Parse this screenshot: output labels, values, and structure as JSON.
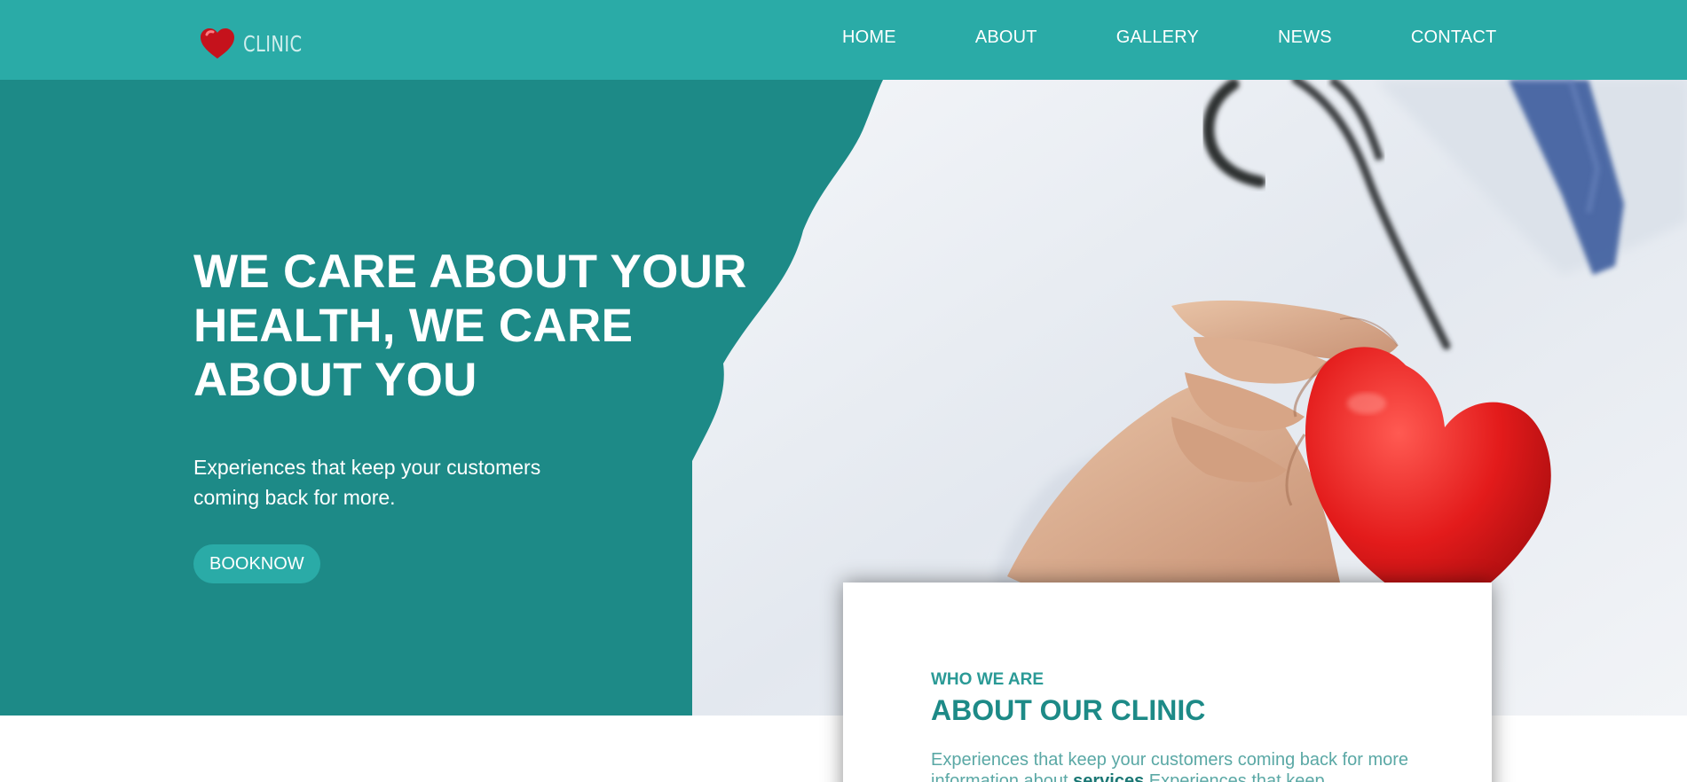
{
  "brand": {
    "name": "CLINIC",
    "logo_icon": "heart-icon"
  },
  "nav": {
    "items": [
      {
        "label": "HOME"
      },
      {
        "label": "ABOUT"
      },
      {
        "label": "GALLERY"
      },
      {
        "label": "NEWS"
      },
      {
        "label": "CONTACT"
      }
    ]
  },
  "hero": {
    "title": "WE CARE ABOUT YOUR HEALTH, WE CARE ABOUT YOU",
    "subtitle": "Experiences that keep your customers coming back for more.",
    "button_label": "BOOKNOW",
    "image": "doctor-holding-heart"
  },
  "about": {
    "kicker": "WHO WE ARE",
    "title": "ABOUT OUR CLINIC",
    "text_before": "Experiences that keep your customers coming back for more information about ",
    "text_bold": "services",
    "text_after": " Experiences that keep"
  },
  "colors": {
    "navbar": "#2aaba7",
    "hero_bg": "#1d8a87",
    "accent": "#2aaba7",
    "heart": "#e21f27"
  }
}
